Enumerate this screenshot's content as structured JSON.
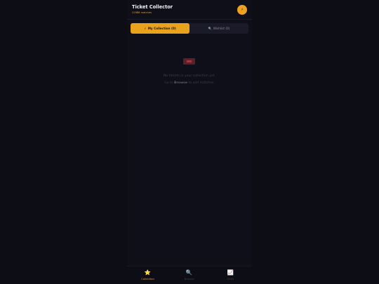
{
  "header": {
    "title": "Ticket Collector",
    "subtitle": "21686 matches",
    "avatar_icon": "⚡"
  },
  "tabs": [
    {
      "icon": "✓",
      "label": "My Collection (0)",
      "active": true
    },
    {
      "icon": "🔍",
      "label": "Wishlist (0)",
      "active": false
    }
  ],
  "empty_state": {
    "line1": "No tickets in your collection yet.",
    "line2_prefix": "Go to",
    "line2_link": "Browse",
    "line2_suffix": "to add matches."
  },
  "bottom_nav": [
    {
      "icon": "⭐",
      "label": "Collection",
      "active": true
    },
    {
      "icon": "🔍",
      "label": "Browse",
      "active": false
    },
    {
      "icon": "📈",
      "label": "Stats",
      "active": false
    }
  ],
  "colors": {
    "accent": "#e8a21c",
    "background": "#0f0f1a",
    "ticket_icon": "#5a2226"
  }
}
